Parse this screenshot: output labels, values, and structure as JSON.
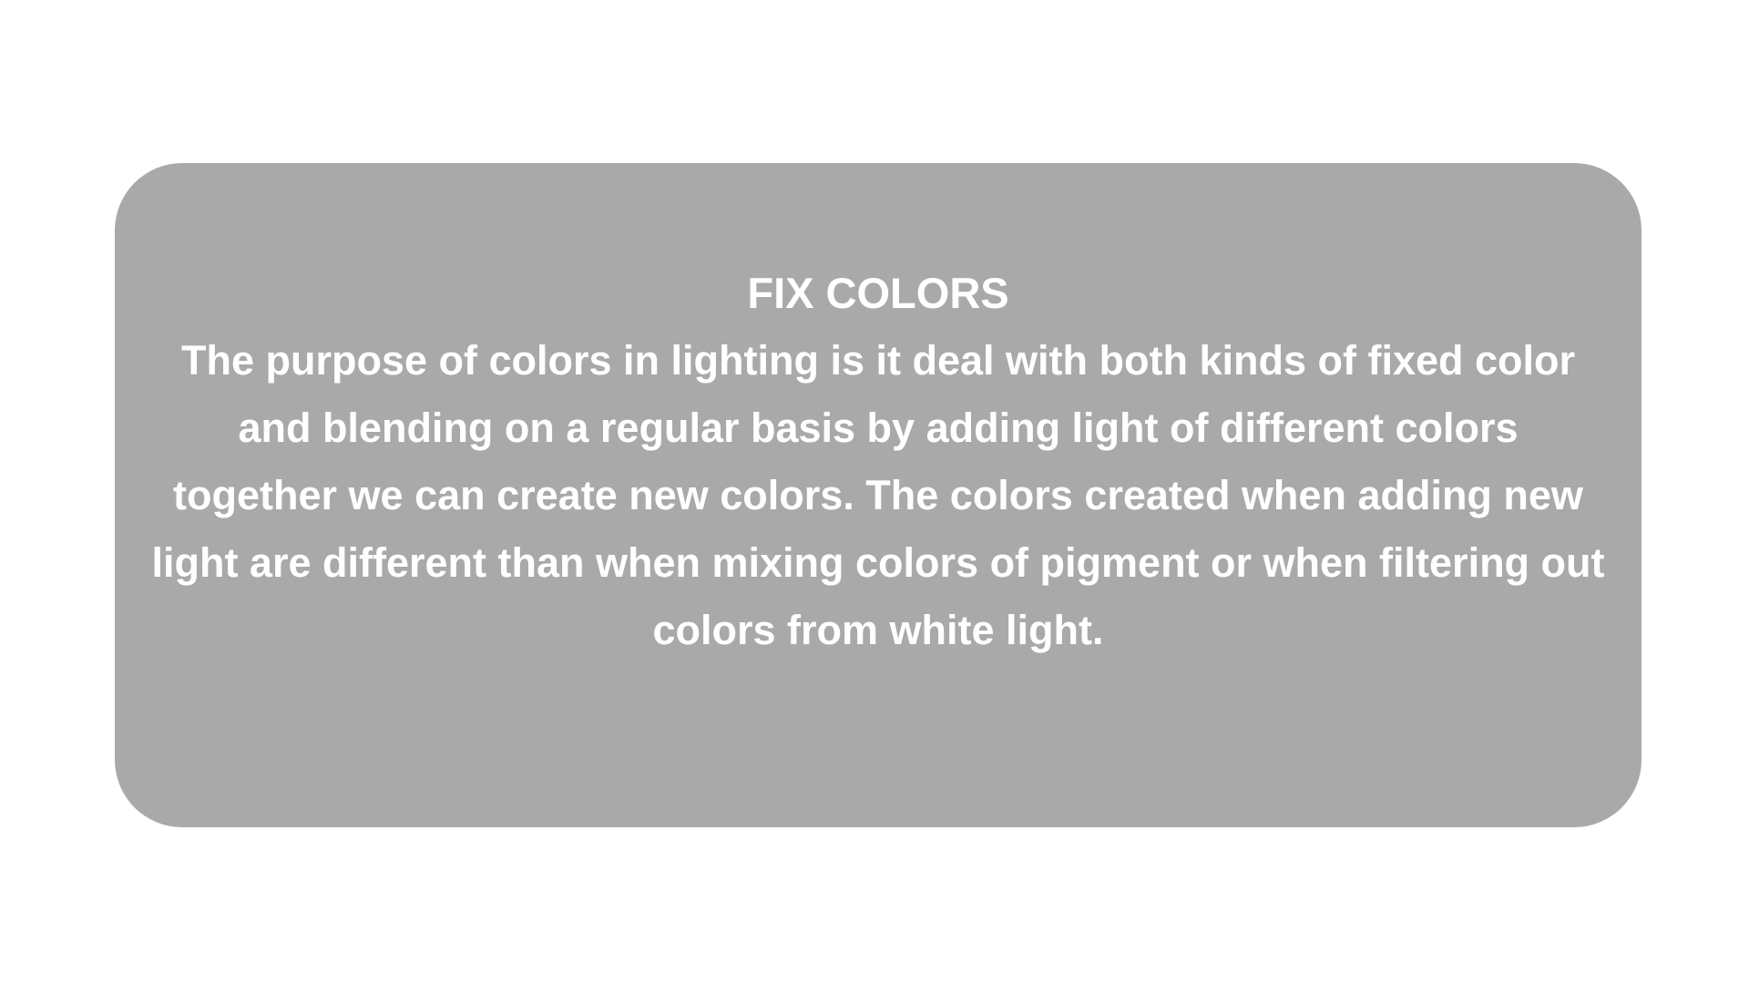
{
  "card": {
    "background_color": "#a9a9a9",
    "text_color": "#ffffff",
    "title": "FIX COLORS",
    "body": "The purpose of colors in lighting is it deal with both kinds of fixed color and blending on a regular basis by adding light of different colors together we can create new colors. The colors created when adding new light are different than when mixing colors of pigment or when filtering out colors from white light."
  }
}
